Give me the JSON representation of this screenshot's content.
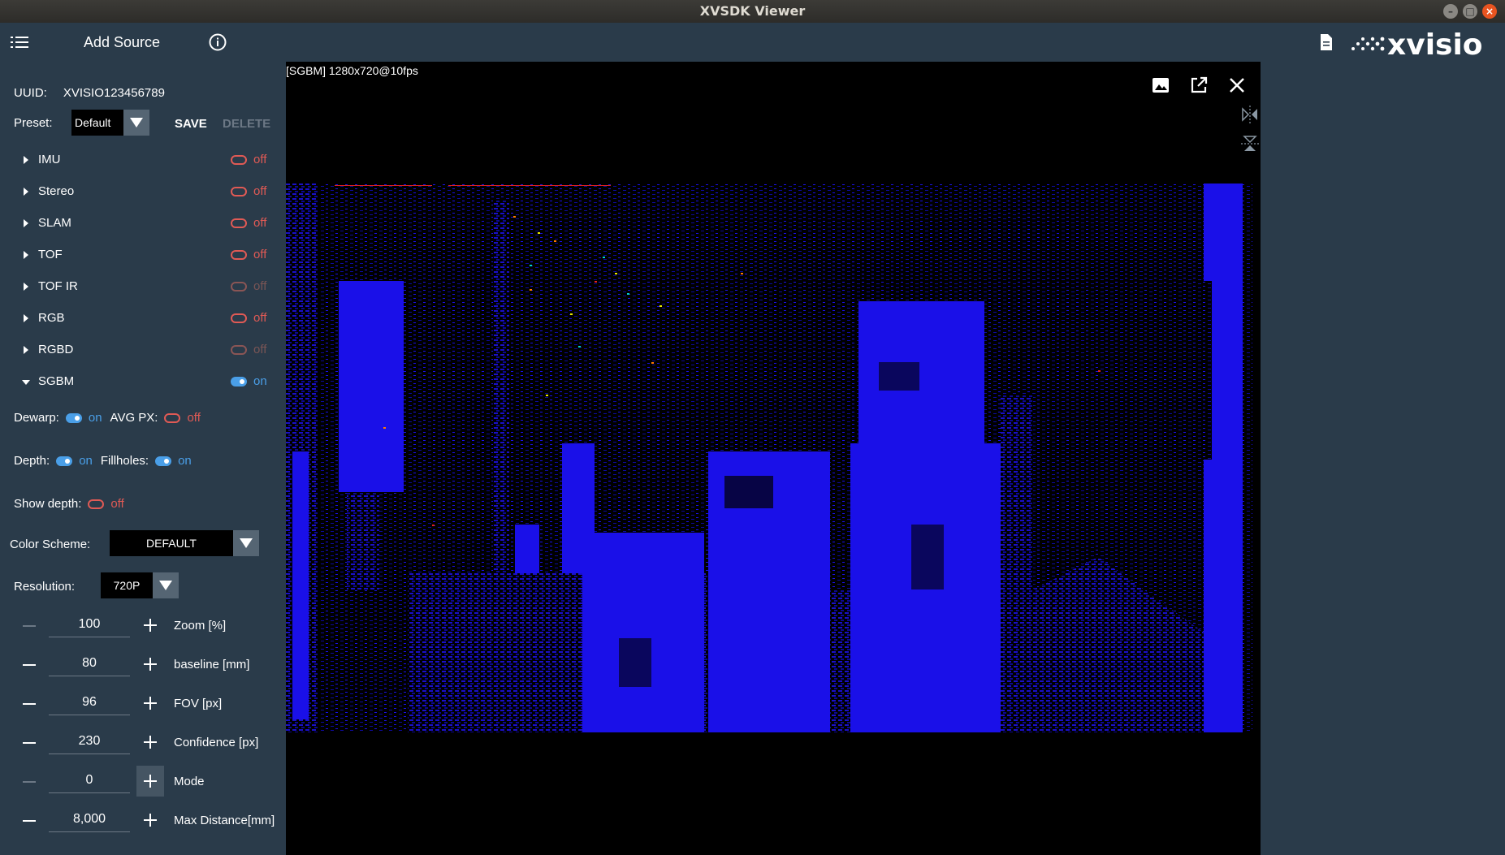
{
  "window": {
    "title": "XVSDK Viewer"
  },
  "appbar": {
    "add_source": "Add Source",
    "logo_text": "xvisio"
  },
  "sidebar": {
    "uuid_label": "UUID:",
    "uuid_value": "XVISIO123456789",
    "preset_label": "Preset:",
    "preset_value": "Default",
    "save": "SAVE",
    "delete": "DELETE",
    "modules": [
      {
        "name": "IMU",
        "state": "off",
        "enabled": true
      },
      {
        "name": "Stereo",
        "state": "off",
        "enabled": true
      },
      {
        "name": "SLAM",
        "state": "off",
        "enabled": true
      },
      {
        "name": "TOF",
        "state": "off",
        "enabled": true
      },
      {
        "name": "TOF IR",
        "state": "off",
        "enabled": false
      },
      {
        "name": "RGB",
        "state": "off",
        "enabled": true
      },
      {
        "name": "RGBD",
        "state": "off",
        "enabled": false
      },
      {
        "name": "SGBM",
        "state": "on",
        "enabled": true
      }
    ],
    "sgbm": {
      "dewarp_label": "Dewarp:",
      "dewarp_state": "on",
      "avgpx_label": "AVG PX:",
      "avgpx_state": "off",
      "depth_label": "Depth:",
      "depth_state": "on",
      "fillholes_label": "Fillholes:",
      "fillholes_state": "on",
      "showdepth_label": "Show depth:",
      "showdepth_state": "off",
      "colorscheme_label": "Color Scheme:",
      "colorscheme_value": "DEFAULT",
      "resolution_label": "Resolution:",
      "resolution_value": "720P",
      "steppers": [
        {
          "value": "100",
          "label": "Zoom [%]"
        },
        {
          "value": "80",
          "label": "baseline [mm]"
        },
        {
          "value": "96",
          "label": "FOV [px]"
        },
        {
          "value": "230",
          "label": "Confidence [px]"
        },
        {
          "value": "0",
          "label": "Mode"
        },
        {
          "value": "8,000",
          "label": "Max Distance[mm]"
        }
      ]
    }
  },
  "viewer": {
    "stream_info": "[SGBM]  1280x720@10fps"
  },
  "colors": {
    "panel": "#2a3b4a",
    "accent_on": "#4a9fe8",
    "accent_off": "#e05a55",
    "depth_blue": "#1a10e8"
  }
}
